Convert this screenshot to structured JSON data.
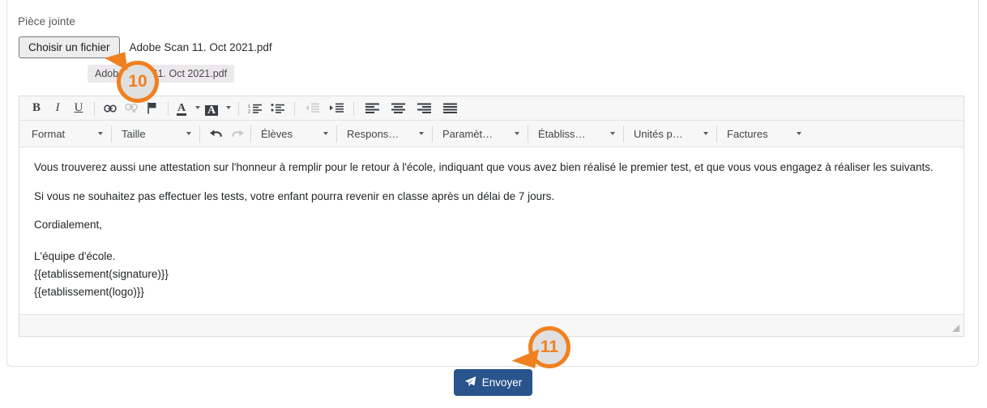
{
  "attachment": {
    "label": "Pièce jointe",
    "choose_button": "Choisir un fichier",
    "file_name": "Adobe Scan 11. Oct 2021.pdf",
    "chip_label": "Adobe Scan 11. Oct 2021.pdf"
  },
  "editor": {
    "toolbar_icons": [
      {
        "name": "bold-icon",
        "glyph": "B"
      },
      {
        "name": "italic-icon",
        "glyph": "I"
      },
      {
        "name": "underline-icon",
        "glyph": "U"
      },
      {
        "name": "insert-link-icon",
        "glyph": "🔗"
      },
      {
        "name": "remove-link-icon",
        "glyph": "🔗"
      },
      {
        "name": "anchor-flag-icon",
        "glyph": "⚑"
      },
      {
        "name": "text-color-icon",
        "glyph": "A"
      },
      {
        "name": "background-color-icon",
        "glyph": "A"
      },
      {
        "name": "ordered-list-icon",
        "glyph": "1."
      },
      {
        "name": "unordered-list-icon",
        "glyph": "•"
      },
      {
        "name": "outdent-icon",
        "glyph": "⇤"
      },
      {
        "name": "indent-icon",
        "glyph": "⇥"
      },
      {
        "name": "align-left-icon",
        "glyph": "≡"
      },
      {
        "name": "align-center-icon",
        "glyph": "≡"
      },
      {
        "name": "align-right-icon",
        "glyph": "≡"
      },
      {
        "name": "align-justify-icon",
        "glyph": "≡"
      }
    ],
    "dropdowns": [
      {
        "name": "format",
        "label": "Format"
      },
      {
        "name": "taille",
        "label": "Taille"
      },
      {
        "name": "eleves",
        "label": "Élèves"
      },
      {
        "name": "responsables",
        "label": "Respons…"
      },
      {
        "name": "parametres",
        "label": "Paramèt…"
      },
      {
        "name": "etablissement",
        "label": "Établiss…"
      },
      {
        "name": "unites",
        "label": "Unités p…"
      },
      {
        "name": "factures",
        "label": "Factures"
      }
    ],
    "undo_label": "undo-icon",
    "redo_label": "redo-icon",
    "content": {
      "p1": "Vous trouverez aussi une attestation sur l'honneur à remplir pour le retour à l'école, indiquant que vous avez bien réalisé le premier test, et que vous vous engagez à réaliser les suivants.",
      "p2": "Si vous ne souhaitez pas effectuer les tests, votre enfant pourra revenir en classe après un délai de 7 jours.",
      "p3": "Cordialement,",
      "p4": "L'équipe d'école.",
      "p5": "{{etablissement(signature)}}",
      "p6": "{{etablissement(logo)}}"
    }
  },
  "footer": {
    "send_label": "Envoyer",
    "send_icon": "send-plane-icon"
  },
  "callouts": [
    {
      "name": "callout-step-10",
      "number": "10"
    },
    {
      "name": "callout-step-11",
      "number": "11"
    }
  ],
  "colors": {
    "accent": "#f08020",
    "send_button": "#29548c",
    "toolbar_bg": "#f7f7f7",
    "card_border": "#e3e3e3"
  }
}
